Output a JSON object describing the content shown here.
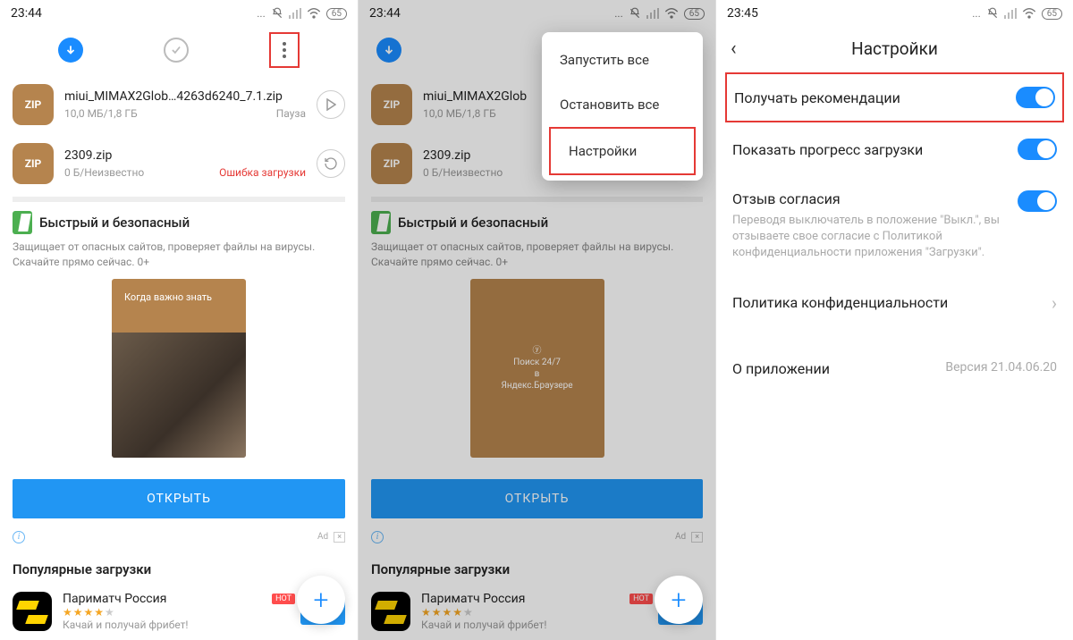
{
  "status": {
    "time_a": "23:44",
    "time_b": "23:44",
    "time_c": "23:45",
    "dots": "...",
    "battery": "65"
  },
  "dl": [
    {
      "name": "miui_MIMAX2Glob…4263d6240_7.1.zip",
      "size": "10,0 МБ/1,8 ГБ",
      "state": "Пауза",
      "err": ""
    },
    {
      "name": "2309.zip",
      "size": "0 Б/Неизвестно",
      "state": "",
      "err": "Ошибка загрузки"
    }
  ],
  "promo": {
    "title": "Быстрый и безопасный",
    "desc": "Защищает от опасных сайтов, проверяет файлы на вирусы. Скачайте прямо сейчас. 0+",
    "tag1": "Когда важно знать",
    "tag2a": "Поиск 24/7",
    "tag2b": "в Яндекс.Браузере",
    "open": "ОТКРЫТЬ",
    "ad": "Ad"
  },
  "popular": {
    "title": "Популярные загрузки",
    "app": {
      "name": "Париматч Россия",
      "sub": "Качай и получай фрибет!",
      "hot": "HOT"
    }
  },
  "menu": {
    "start_all": "Запустить все",
    "stop_all": "Остановить все",
    "settings": "Настройки"
  },
  "settings": {
    "title": "Настройки",
    "recommend": "Получать рекомендации",
    "progress": "Показать прогресс загрузки",
    "consent_title": "Отзыв согласия",
    "consent_desc": "Переводя выключатель в положение \"Выкл.\", вы отзываете свое согласие с Политикой конфиденциальности приложения \"Загрузки\".",
    "privacy": "Политика конфиденциальности",
    "about": "О приложении",
    "version": "Версия 21.04.06.20"
  }
}
